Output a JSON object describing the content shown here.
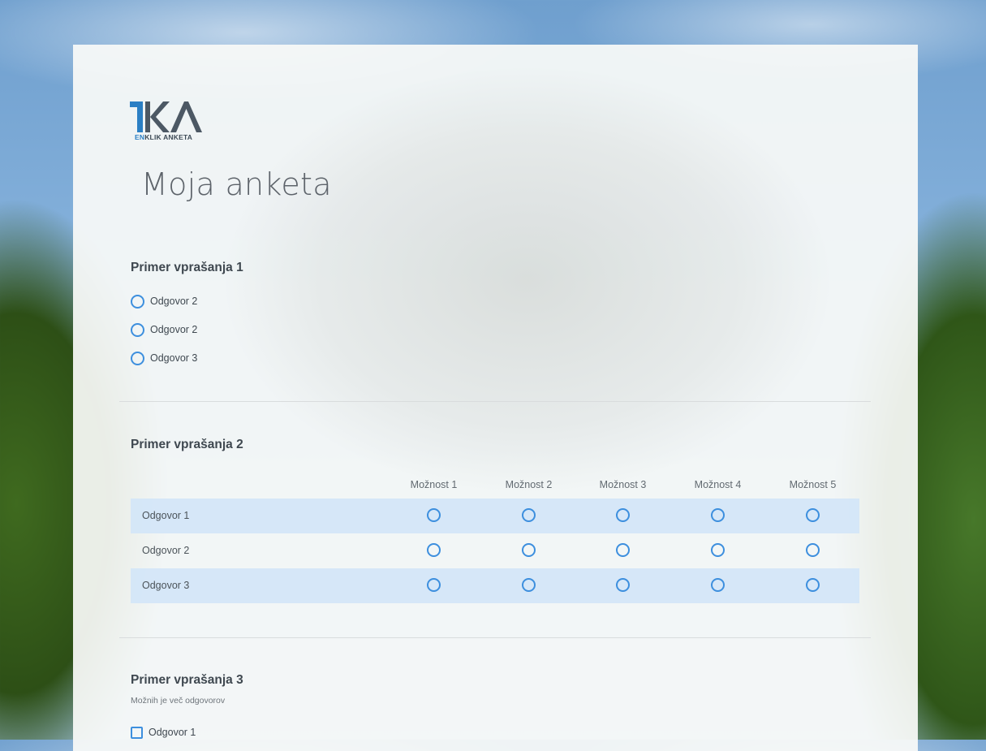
{
  "app": {
    "logo_mark": "1KA",
    "logo_prefix": "EN",
    "logo_suffix": "KLIK ANKETA"
  },
  "survey": {
    "title": "Moja anketa"
  },
  "question1": {
    "title": "Primer vprašanja 1",
    "options": [
      "Odgovor 2",
      "Odgovor 2",
      "Odgovor 3"
    ]
  },
  "question2": {
    "title": "Primer vprašanja 2",
    "columns": [
      "Možnost 1",
      "Možnost 2",
      "Možnost 3",
      "Možnost 4",
      "Možnost 5"
    ],
    "rows": [
      "Odgovor 1",
      "Odgovor 2",
      "Odgovor 3"
    ]
  },
  "question3": {
    "title": "Primer vprašanja 3",
    "hint": "Možnih je več odgovorov",
    "options": [
      "Odgovor 1"
    ]
  },
  "colors": {
    "accent": "#3d8fde",
    "row_highlight": "#d2e5f8",
    "logo_blue": "#2b7fc4",
    "logo_gray": "#4c5864"
  },
  "icons": {
    "radio": "radio-circle",
    "checkbox": "checkbox-square"
  }
}
